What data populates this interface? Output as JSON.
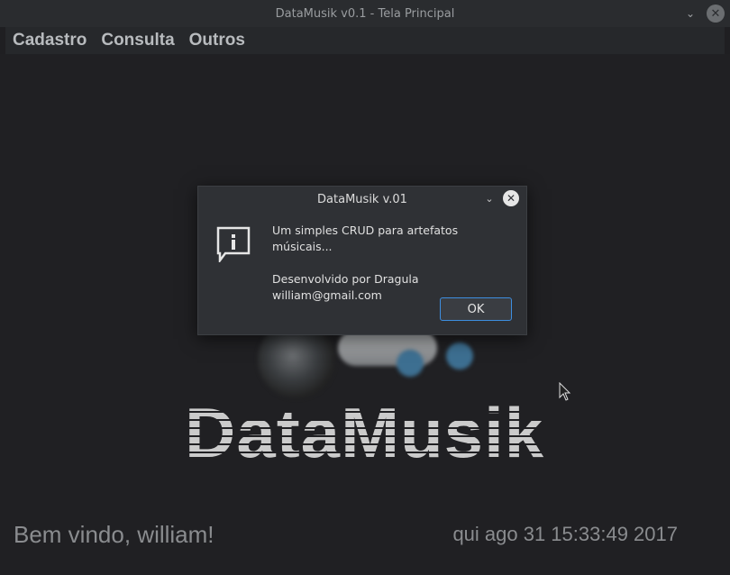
{
  "window": {
    "title": "DataMusik v0.1 - Tela Principal",
    "chevron_icon": "chevron-down-icon",
    "close_icon": "close-icon"
  },
  "menu": {
    "items": [
      {
        "label": "Cadastro"
      },
      {
        "label": "Consulta"
      },
      {
        "label": "Outros"
      }
    ]
  },
  "main": {
    "logo_text": "DataMusik",
    "welcome": "Bem vindo, william!",
    "datetime": "qui ago 31 15:33:49 2017"
  },
  "dialog": {
    "title": "DataMusik v.01",
    "message_line1": "Um simples CRUD para artefatos músicais...",
    "message_line2": "Desenvolvido por Dragula",
    "message_line3": "william@gmail.com",
    "ok_label": "OK",
    "icon": "info-icon"
  },
  "colors": {
    "background": "#1f1f22",
    "dialog_bg": "#2f3135",
    "accent_focus": "#3d8ee0"
  }
}
